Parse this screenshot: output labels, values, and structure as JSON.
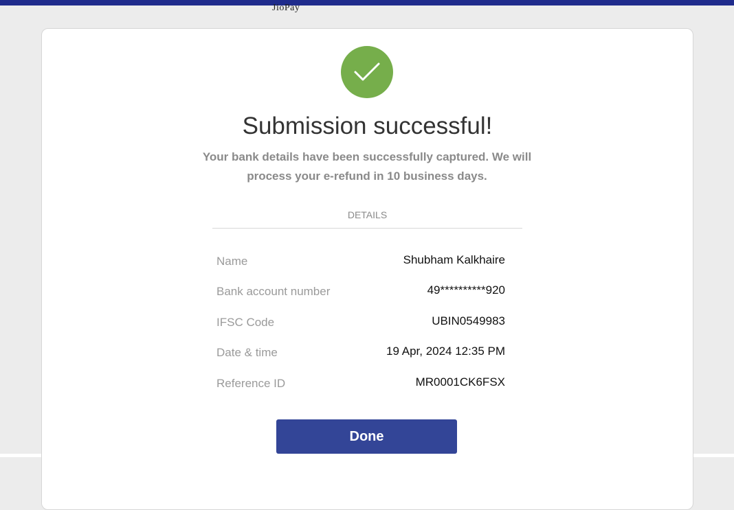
{
  "header": {
    "brand": "JioPay",
    "accent_color": "#1f2b8c"
  },
  "status": {
    "icon": "checkmark-icon",
    "color": "#76ae4b",
    "title": "Submission successful!",
    "message": "Your bank details have been successfully captured. We will process your e-refund in 10 business days."
  },
  "details": {
    "heading": "DETAILS",
    "rows": [
      {
        "label": "Name",
        "value": "Shubham Kalkhaire"
      },
      {
        "label": "Bank account number",
        "value": "49**********920"
      },
      {
        "label": "IFSC Code",
        "value": "UBIN0549983"
      },
      {
        "label": "Date & time",
        "value": "19 Apr, 2024 12:35 PM"
      },
      {
        "label": "Reference ID",
        "value": "MR0001CK6FSX"
      }
    ]
  },
  "actions": {
    "done_label": "Done",
    "button_color": "#334597"
  }
}
